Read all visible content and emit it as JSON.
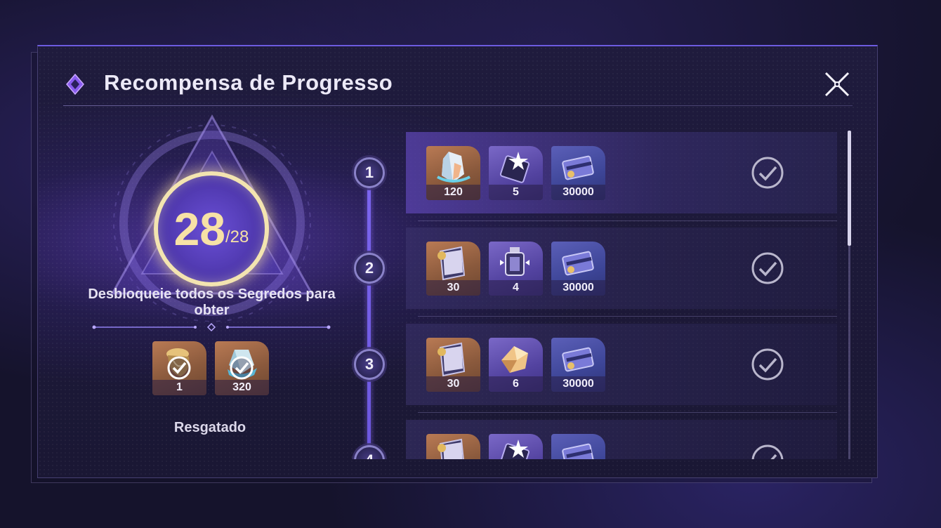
{
  "header": {
    "title": "Recompensa de Progresso"
  },
  "progress": {
    "current": "28",
    "total": "/28"
  },
  "unlock_text": "Desbloqueie todos os Segredos para obter",
  "final_rewards": [
    {
      "icon": "golden-relic-icon",
      "qty": "1",
      "claimed": true
    },
    {
      "icon": "crystal-gem-icon",
      "qty": "320",
      "claimed": true
    }
  ],
  "claimed_label": "Resgatado",
  "tiers": [
    {
      "number": "1",
      "rewards": [
        {
          "icon": "crystal-shard-icon",
          "qty": "120"
        },
        {
          "icon": "star-ticket-icon",
          "qty": "5"
        },
        {
          "icon": "credit-card-icon",
          "qty": "30000"
        }
      ],
      "claimed": true
    },
    {
      "number": "2",
      "rewards": [
        {
          "icon": "book-icon",
          "qty": "30"
        },
        {
          "icon": "lantern-icon",
          "qty": "4"
        },
        {
          "icon": "credit-card-icon",
          "qty": "30000"
        }
      ],
      "claimed": true
    },
    {
      "number": "3",
      "rewards": [
        {
          "icon": "book-icon",
          "qty": "30"
        },
        {
          "icon": "gold-ore-icon",
          "qty": "6"
        },
        {
          "icon": "credit-card-icon",
          "qty": "30000"
        }
      ],
      "claimed": true
    },
    {
      "number": "4",
      "rewards": [
        {
          "icon": "book-icon",
          "qty": ""
        },
        {
          "icon": "star-ticket-icon",
          "qty": ""
        },
        {
          "icon": "credit-card-icon",
          "qty": ""
        }
      ],
      "claimed": true
    }
  ],
  "colors": {
    "accent": "#6d5be0",
    "gold": "#f7e2a6",
    "panel": "#1f1b3d"
  }
}
